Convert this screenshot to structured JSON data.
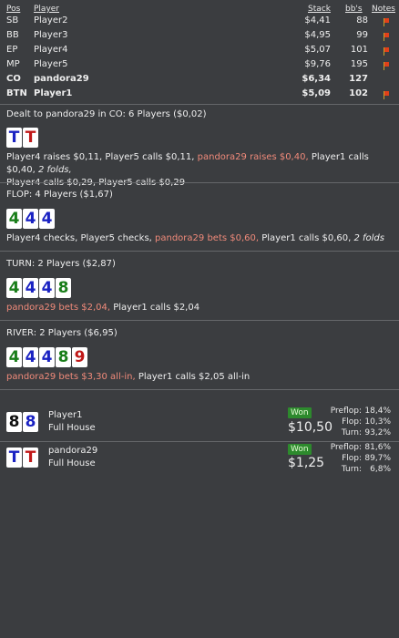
{
  "columns": {
    "pos": "Pos",
    "player": "Player",
    "stack": "Stack",
    "bbs": "bb's",
    "notes": "Notes"
  },
  "players": [
    {
      "pos": "SB",
      "name": "Player2",
      "stack": "$4,41",
      "bbs": "88"
    },
    {
      "pos": "BB",
      "name": "Player3",
      "stack": "$4,95",
      "bbs": "99"
    },
    {
      "pos": "EP",
      "name": "Player4",
      "stack": "$5,07",
      "bbs": "101"
    },
    {
      "pos": "MP",
      "name": "Player5",
      "stack": "$9,76",
      "bbs": "195"
    },
    {
      "pos": "CO",
      "name": "pandora29",
      "stack": "$6,34",
      "bbs": "127"
    },
    {
      "pos": "BTN",
      "name": "Player1",
      "stack": "$5,09",
      "bbs": "102"
    }
  ],
  "preflop": {
    "title": "Dealt to pandora29 in CO: 6 Players ($0,02)",
    "cards": [
      {
        "rank": "T",
        "suit": "d"
      },
      {
        "rank": "T",
        "suit": "h"
      }
    ],
    "a1": "Player4 raises $0,11, Player5 calls $0,11, ",
    "a2": "pandora29 raises $0,40,",
    "a3": " Player1 calls $0,40, ",
    "a4": "2 folds,",
    "a5": "Player4 calls $0,29, Player5 calls $0,29"
  },
  "flop": {
    "title": "FLOP: 4 Players ($1,67)",
    "cards": [
      {
        "rank": "4",
        "suit": "c"
      },
      {
        "rank": "4",
        "suit": "d"
      },
      {
        "rank": "4",
        "suit": "d"
      }
    ],
    "a1": "Player4 checks, Player5 checks, ",
    "a2": "pandora29 bets $0,60,",
    "a3": " Player1 calls $0,60, ",
    "a4": "2 folds"
  },
  "turn": {
    "title": "TURN: 2 Players ($2,87)",
    "cards": [
      {
        "rank": "4",
        "suit": "c"
      },
      {
        "rank": "4",
        "suit": "d"
      },
      {
        "rank": "4",
        "suit": "d"
      },
      {
        "rank": "8",
        "suit": "c"
      }
    ],
    "a1": "pandora29 bets $2,04,",
    "a2": " Player1 calls $2,04"
  },
  "river": {
    "title": "RIVER: 2 Players ($6,95)",
    "cards": [
      {
        "rank": "4",
        "suit": "c"
      },
      {
        "rank": "4",
        "suit": "d"
      },
      {
        "rank": "4",
        "suit": "d"
      },
      {
        "rank": "8",
        "suit": "c"
      },
      {
        "rank": "9",
        "suit": "h"
      }
    ],
    "a1": "pandora29 bets $3,30 all-in,",
    "a2": " Player1 calls $2,05 all-in"
  },
  "showdown": [
    {
      "name": "Player1",
      "hand": "Full House",
      "won_label": "Won",
      "amount": "$10,50",
      "cards": [
        {
          "rank": "8",
          "suit": "s"
        },
        {
          "rank": "8",
          "suit": "d"
        }
      ],
      "stats": [
        {
          "label": "Preflop:",
          "value": "18,4%"
        },
        {
          "label": "Flop:",
          "value": "10,3%"
        },
        {
          "label": "Turn:",
          "value": "93,2%"
        }
      ]
    },
    {
      "name": "pandora29",
      "hand": "Full House",
      "won_label": "Won",
      "amount": "$1,25",
      "cards": [
        {
          "rank": "T",
          "suit": "d"
        },
        {
          "rank": "T",
          "suit": "h"
        }
      ],
      "stats": [
        {
          "label": "Preflop:",
          "value": "81,6%"
        },
        {
          "label": "Flop:",
          "value": "89,7%"
        },
        {
          "label": "Turn:",
          "value": "6,8%"
        }
      ]
    }
  ],
  "colors": {
    "background": "#3b3d40",
    "hero_action": "#f08a7a",
    "won_badge": "#2d8a2d",
    "hearts": "#c01818",
    "diamonds": "#1a22c2",
    "clubs": "#1a7e1a",
    "spades": "#111111"
  }
}
